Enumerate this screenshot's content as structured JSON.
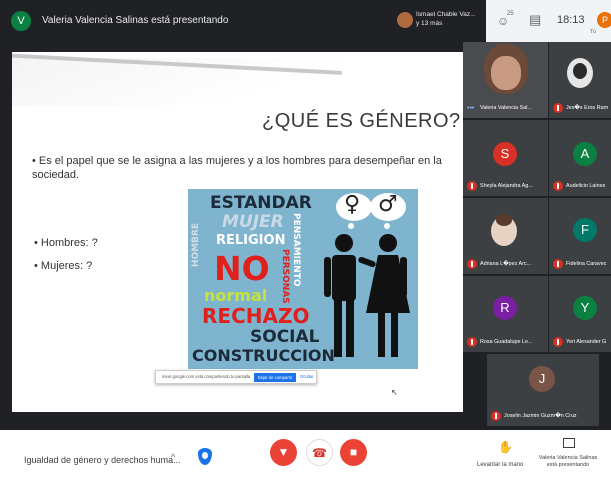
{
  "topbar": {
    "presenter_initial": "V",
    "presenter_text": "Valeria Valencia Salinas está presentando",
    "notification_line1": "Ismael Chable Vaz...",
    "notification_line2": "y 13 más",
    "people_icon": "people-icon",
    "people_count": "25",
    "chat_icon": "chat-icon",
    "time": "18:13",
    "user_initial": "P",
    "user_label": "Tú"
  },
  "slide": {
    "title": "¿QUÉ ES GÉNERO?",
    "bullet1": "• Es el papel que se le asigna a las mujeres y a los hombres para desempeñar en la sociedad.",
    "bullet2": "• Hombres: ?",
    "bullet3": "• Mujeres: ?",
    "poster_words": [
      "ESTANDAR",
      "MUJER",
      "RELIGION",
      "NO",
      "normal",
      "PERSONAS",
      "PENSAMIENTO",
      "HOMBRE",
      "RECHAZO",
      "SOCIAL",
      "CONSTRUCCION"
    ],
    "poster_symbols": [
      "♀",
      "♂"
    ],
    "share_text": "meet.google.com está compartiendo tu pantalla.",
    "share_stop": "Dejar de compartir",
    "share_hide": "Ocultar"
  },
  "participants": [
    {
      "name": "Valeria Valencia Sal...",
      "type": "photo",
      "speaking": true
    },
    {
      "name": "Jes�s Eros Ram",
      "type": "photo",
      "muted": true
    },
    {
      "name": "Sheyla Alejandra Ag...",
      "initial": "S",
      "color": "#d93025",
      "muted": true
    },
    {
      "name": "Audelicio Laines",
      "initial": "A",
      "color": "#0b8043",
      "muted": true
    },
    {
      "name": "Adriana L�pez Arc...",
      "type": "photo",
      "muted": true
    },
    {
      "name": "Fidelina Caravec",
      "initial": "F",
      "color": "#00796b",
      "muted": true
    },
    {
      "name": "Rosa Guadalupe Le...",
      "initial": "R",
      "color": "#7b1fa2",
      "muted": true
    },
    {
      "name": "Yeri Alexander G",
      "initial": "Y",
      "color": "#0b8043",
      "muted": true
    },
    {
      "name": "Joselin Jazmin Guzm�n Cruz",
      "initial": "J",
      "color": "#795548",
      "muted": true
    }
  ],
  "bottombar": {
    "meeting_name": "Igualdad de género y derechos huma...",
    "chevron": "^",
    "raise_hand_label": "Levantar la mano",
    "presenting_label": "Valeria Valencia Salinas está presentando"
  }
}
